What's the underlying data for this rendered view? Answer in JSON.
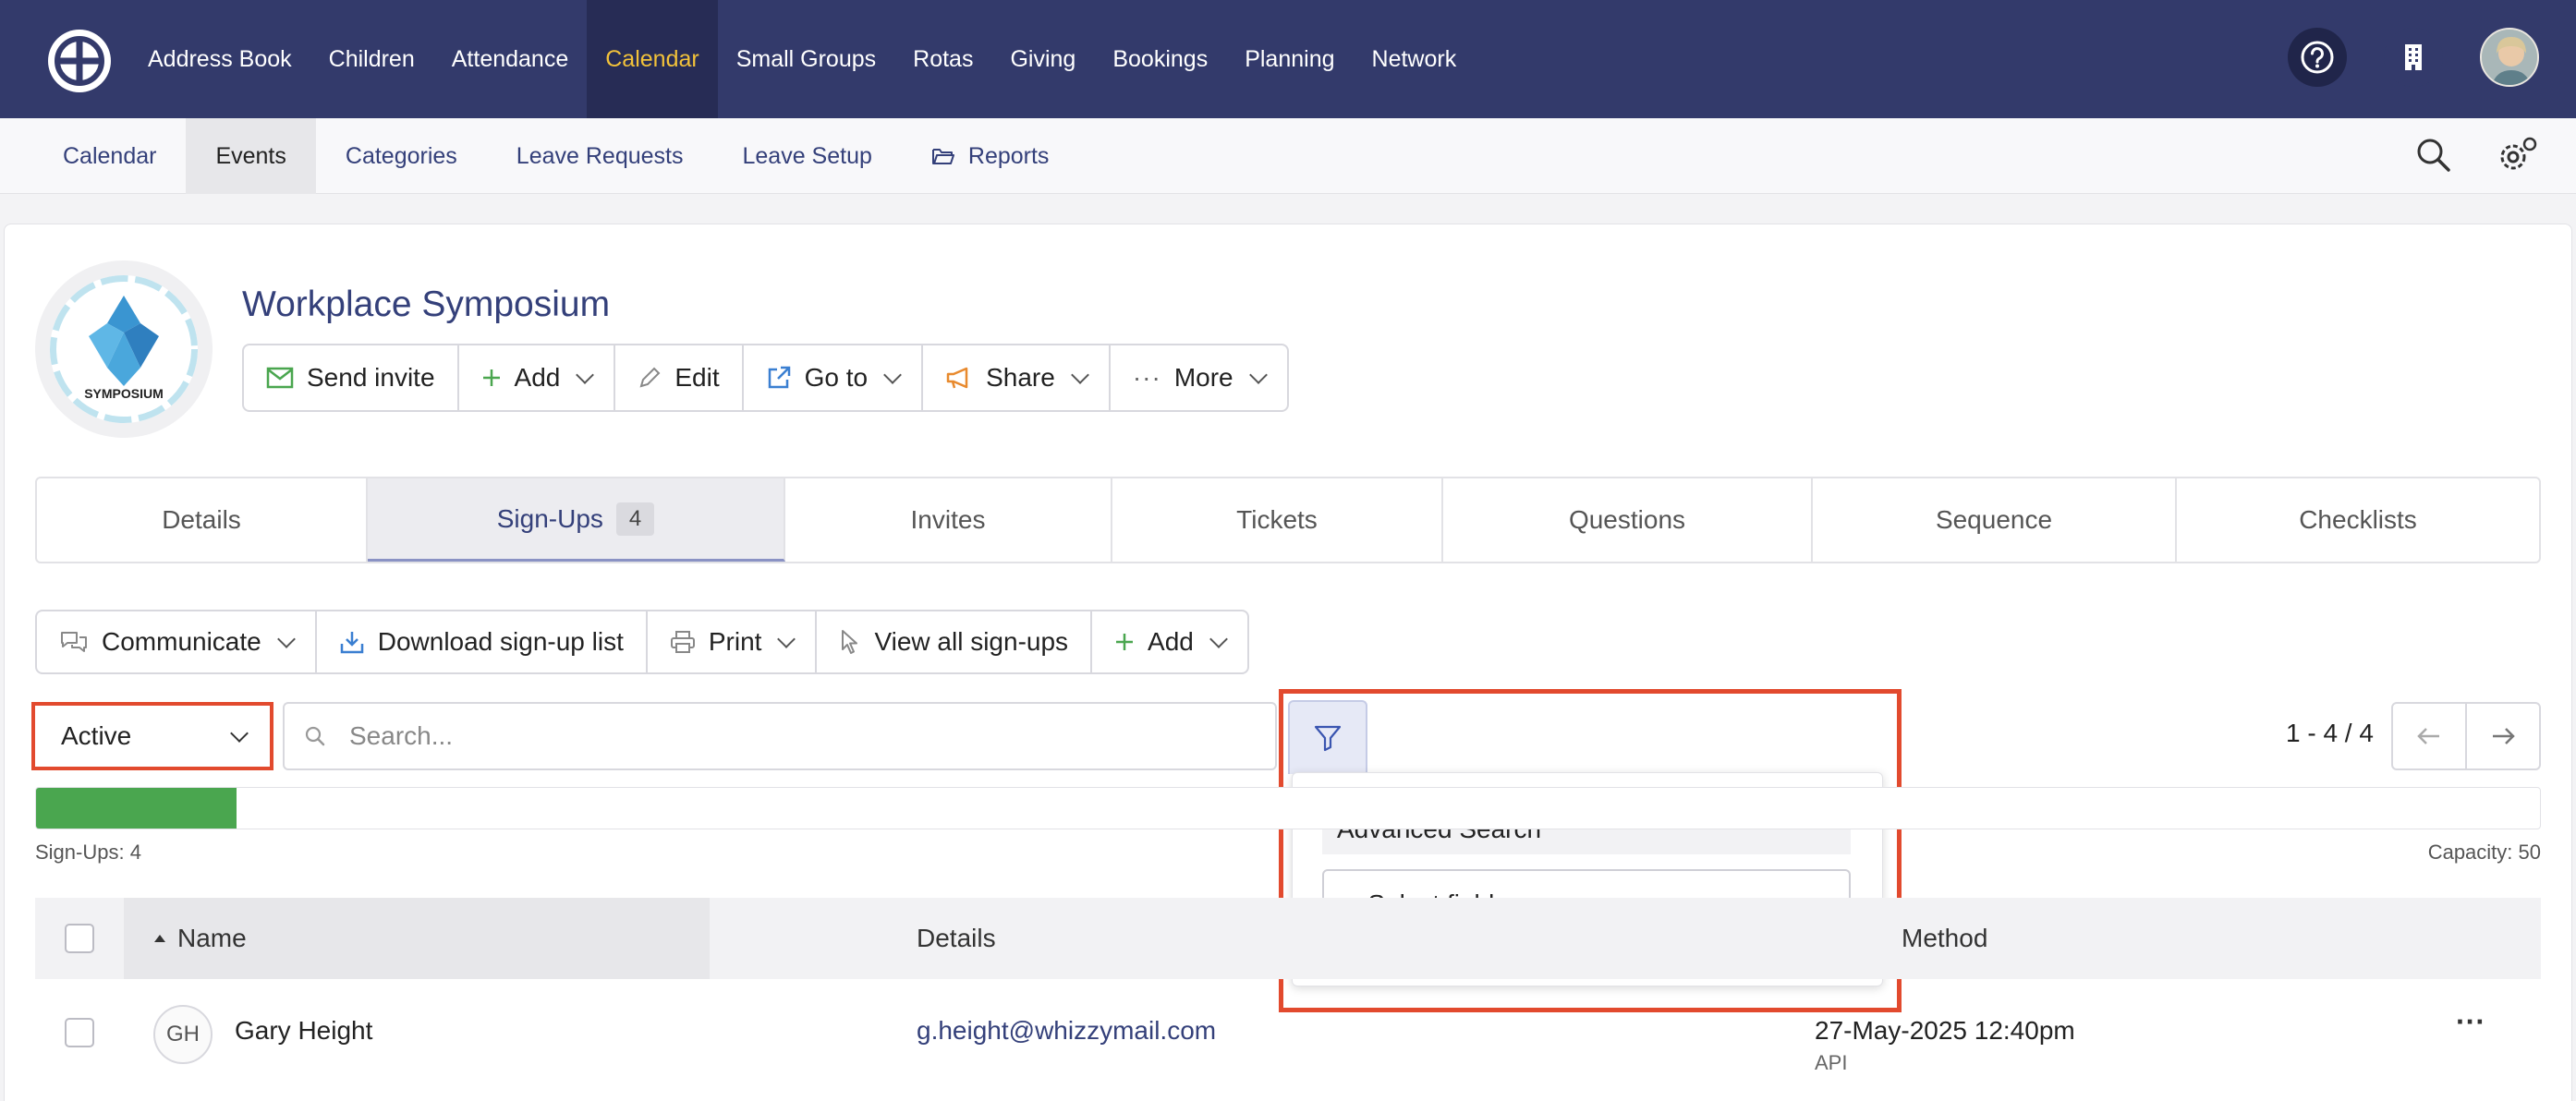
{
  "topnav": {
    "items": [
      "Address Book",
      "Children",
      "Attendance",
      "Calendar",
      "Small Groups",
      "Rotas",
      "Giving",
      "Bookings",
      "Planning",
      "Network"
    ],
    "active": "Calendar"
  },
  "subnav": {
    "items": [
      "Calendar",
      "Events",
      "Categories",
      "Leave Requests",
      "Leave Setup",
      "Reports"
    ],
    "active": "Events"
  },
  "event": {
    "title": "Workplace Symposium",
    "logo_text": "SYMPOSIUM"
  },
  "actions": {
    "send_invite": "Send invite",
    "add": "Add",
    "edit": "Edit",
    "go_to": "Go to",
    "share": "Share",
    "more": "More"
  },
  "tabs": {
    "details": "Details",
    "signups": "Sign-Ups",
    "signups_count": "4",
    "invites": "Invites",
    "tickets": "Tickets",
    "questions": "Questions",
    "sequence": "Sequence",
    "checklists": "Checklists"
  },
  "toolbar": {
    "communicate": "Communicate",
    "download": "Download sign-up list",
    "print": "Print",
    "view_all": "View all sign-ups",
    "add": "Add"
  },
  "filters": {
    "status_value": "Active",
    "search_placeholder": "Search...",
    "advanced_search_label": "Advanced Search",
    "select_field_value": "– Select field –"
  },
  "pager": {
    "label": "1 - 4 / 4"
  },
  "capacity": {
    "signups_label": "Sign-Ups: 4",
    "capacity_label": "Capacity: 50",
    "fill_fraction": 0.08
  },
  "table": {
    "columns": {
      "name": "Name",
      "details": "Details",
      "method": "Method"
    },
    "rows": [
      {
        "initials": "GH",
        "name": "Gary Height",
        "email": "g.height@whizzymail.com",
        "date": "27-May-2025 12:40pm",
        "method": "API"
      }
    ]
  },
  "colors": {
    "nav_bg": "#333a6b",
    "nav_active": "#f2c23a",
    "highlight": "#e24a2e",
    "progress": "#4aa64f",
    "link": "#34407a"
  }
}
